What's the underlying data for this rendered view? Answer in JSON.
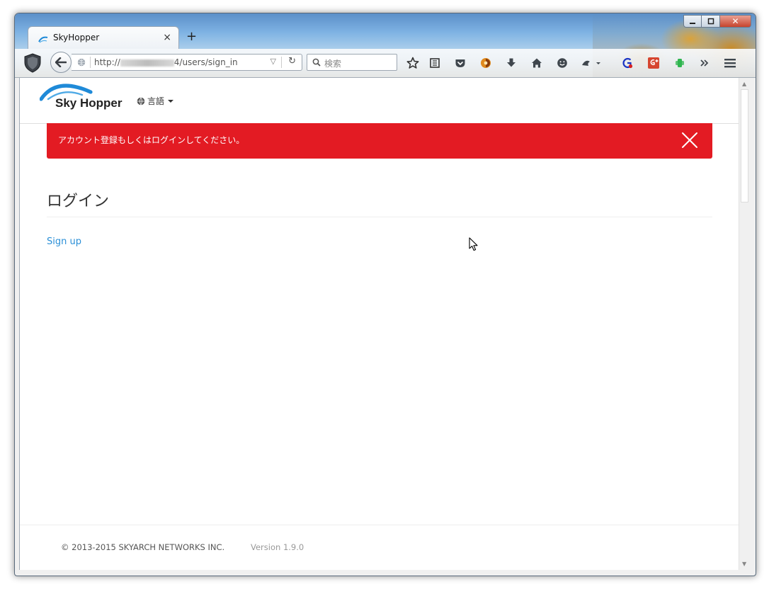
{
  "browser": {
    "tab_title": "SkyHopper",
    "tab_close": "×",
    "new_tab": "+",
    "url_prefix": "http://",
    "url_suffix": "4/users/sign_in",
    "search_placeholder": "検索",
    "window_close": "✕"
  },
  "site": {
    "logo_text": "Sky Hopper",
    "language_label": "言語"
  },
  "alert": {
    "message": "アカウント登録もしくはログインしてください。"
  },
  "main": {
    "page_title": "ログイン",
    "signup_link": "Sign up"
  },
  "footer": {
    "copyright": "© 2013-2015 SKYARCH NETWORKS INC.",
    "version": "Version 1.9.0"
  },
  "colors": {
    "alert_bg": "#e31b23",
    "link": "#2a8fd7"
  }
}
